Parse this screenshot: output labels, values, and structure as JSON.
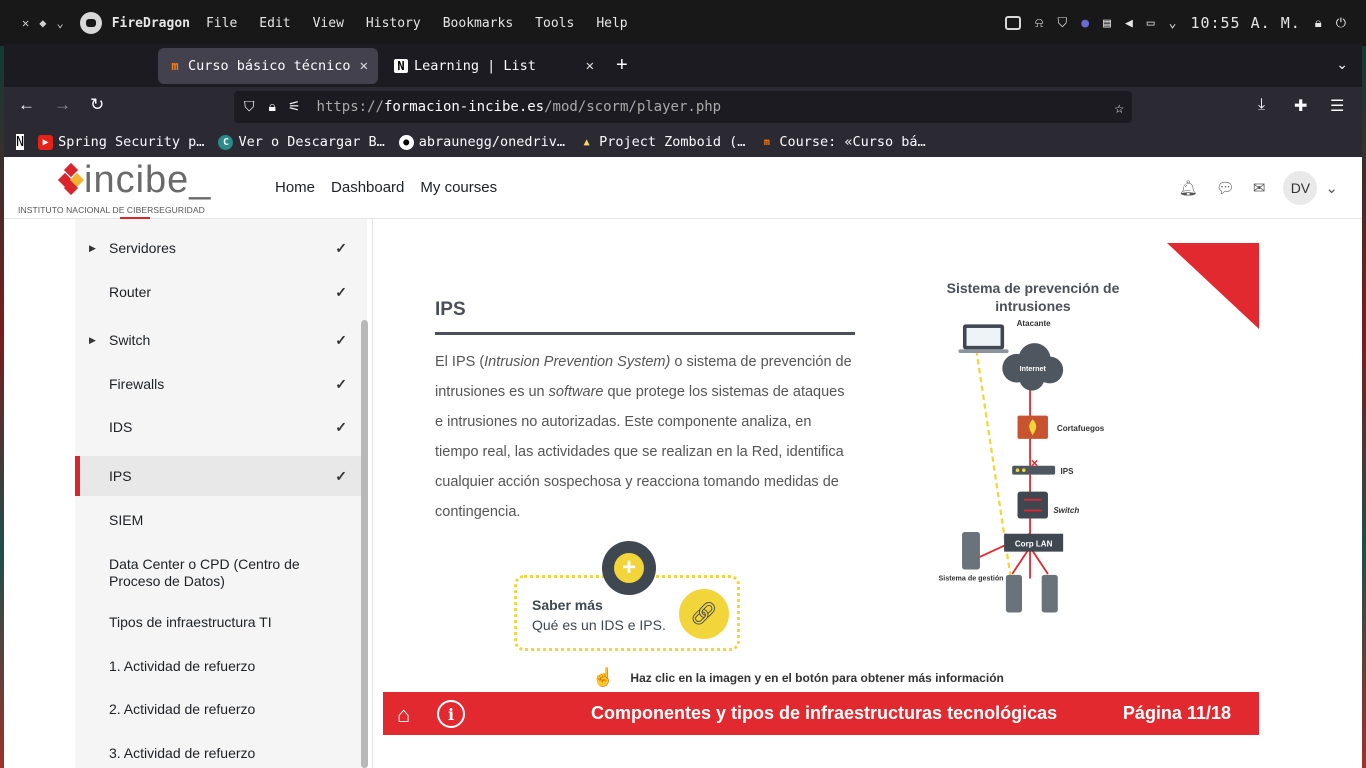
{
  "system_bar": {
    "app_name": "FireDragon",
    "menu": [
      "File",
      "Edit",
      "View",
      "History",
      "Bookmarks",
      "Tools",
      "Help"
    ],
    "clock": "10:55 A. M."
  },
  "tabs": [
    {
      "title": "Curso básico técnico",
      "active": true
    },
    {
      "title": "Learning | List",
      "active": false
    }
  ],
  "url": {
    "scheme": "https://",
    "domain": "formacion-incibe.es",
    "path": "/mod/scorm/player.php"
  },
  "bookmarks": [
    {
      "label": "Spring Security p…",
      "icon": "youtube-icon"
    },
    {
      "label": "Ver o Descargar B…",
      "icon": "c-icon"
    },
    {
      "label": "abraunegg/onedriv…",
      "icon": "github-icon"
    },
    {
      "label": "Project Zomboid (…",
      "icon": "linux-icon"
    },
    {
      "label": "Course: «Curso bá…",
      "icon": "moodle-icon"
    }
  ],
  "site": {
    "logo_word": "incibe_",
    "logo_sub": "INSTITUTO NACIONAL DE CIBERSEGURIDAD",
    "nav": [
      "Home",
      "Dashboard",
      "My courses"
    ],
    "avatar_initials": "DV"
  },
  "sidebar": {
    "items": [
      {
        "label": "Servidores",
        "expandable": true,
        "done": true
      },
      {
        "label": "Router",
        "expandable": false,
        "done": true
      },
      {
        "label": "Switch",
        "expandable": true,
        "done": true
      },
      {
        "label": "Firewalls",
        "expandable": false,
        "done": true
      },
      {
        "label": "IDS",
        "expandable": false,
        "done": true
      },
      {
        "label": "IPS",
        "expandable": false,
        "done": true,
        "active": true
      },
      {
        "label": "SIEM",
        "expandable": false,
        "done": false
      },
      {
        "label": "Data Center o CPD (Centro de Proceso de Datos)",
        "expandable": false,
        "done": false
      },
      {
        "label": "Tipos de infraestructura TI",
        "expandable": false,
        "done": false
      },
      {
        "label": "1. Actividad de refuerzo",
        "expandable": false,
        "done": false
      },
      {
        "label": "2. Actividad de refuerzo",
        "expandable": false,
        "done": false
      },
      {
        "label": "3. Actividad de refuerzo",
        "expandable": false,
        "done": false
      }
    ]
  },
  "lesson": {
    "title": "IPS",
    "body_parts": {
      "p1": "El IPS (",
      "p2": "Intrusion Prevention System)",
      "p3": " o sistema de prevención de intrusiones es un ",
      "p4": "software",
      "p5": " que protege los sistemas de ataques e intrusiones no autorizadas. Este componente analiza, en tiempo real, las actividades que se realizan en la Red, identifica cualquier acción sospechosa y reacciona tomando medidas de contingencia."
    },
    "saber_mas_title": "Saber más",
    "saber_mas_text": "Qué es un IDS e IPS.",
    "hint": "Haz clic en la imagen y en el botón para obtener más información"
  },
  "diagram": {
    "title": "Sistema de prevención de intrusiones",
    "labels": {
      "attacker": "Atacante",
      "internet": "Internet",
      "firewall": "Cortafuegos",
      "ips": "IPS",
      "switch": "Switch",
      "lan": "Corp LAN",
      "mgmt": "Sistema de gestión"
    }
  },
  "footer": {
    "title": "Componentes y tipos de infraestructuras tecnológicas",
    "page": "Página 11/18"
  },
  "colors": {
    "accent_red": "#e1292f",
    "yellow": "#f2d43b",
    "dark": "#3f4750"
  }
}
